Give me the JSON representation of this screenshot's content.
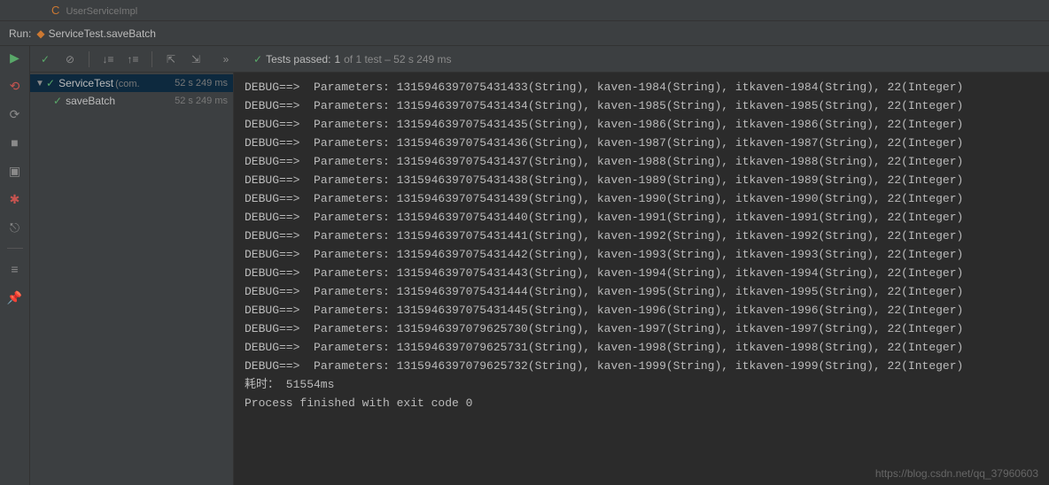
{
  "topbar": {
    "breadcrumb_prefix_icon": "C",
    "breadcrumb_text": "UserServiceImpl"
  },
  "toolbar": {
    "run_label": "Run:",
    "file_icon": "◆",
    "file_name": "ServiceTest.saveBatch"
  },
  "gutter": {
    "run": "▶",
    "stop": "⟲",
    "rerun": "⟳",
    "stop2": "■",
    "camera": "▣",
    "debug": "✱",
    "exit": "⎋",
    "layout": "≡",
    "pin": "📌"
  },
  "toolbar_inner": {
    "check": "✓",
    "block": "⊘",
    "sort_down": "↓≡",
    "sort_up": "↑≡",
    "expand": "⇱",
    "collapse": "⇲",
    "more": "»"
  },
  "test_status": {
    "icon": "✓",
    "label": "Tests passed:",
    "count": "1",
    "of_text": "of 1 test – 52 s 249 ms"
  },
  "tree": {
    "root": {
      "chevron": "▼",
      "check": "✓",
      "name": "ServiceTest",
      "dim": "(com.",
      "time": "52 s 249 ms"
    },
    "child": {
      "check": "✓",
      "name": "saveBatch",
      "time": "52 s 249 ms"
    }
  },
  "console_lines": [
    "DEBUG==>  Parameters: 1315946397075431433(String), kaven-1984(String), itkaven-1984(String), 22(Integer)",
    "DEBUG==>  Parameters: 1315946397075431434(String), kaven-1985(String), itkaven-1985(String), 22(Integer)",
    "DEBUG==>  Parameters: 1315946397075431435(String), kaven-1986(String), itkaven-1986(String), 22(Integer)",
    "DEBUG==>  Parameters: 1315946397075431436(String), kaven-1987(String), itkaven-1987(String), 22(Integer)",
    "DEBUG==>  Parameters: 1315946397075431437(String), kaven-1988(String), itkaven-1988(String), 22(Integer)",
    "DEBUG==>  Parameters: 1315946397075431438(String), kaven-1989(String), itkaven-1989(String), 22(Integer)",
    "DEBUG==>  Parameters: 1315946397075431439(String), kaven-1990(String), itkaven-1990(String), 22(Integer)",
    "DEBUG==>  Parameters: 1315946397075431440(String), kaven-1991(String), itkaven-1991(String), 22(Integer)",
    "DEBUG==>  Parameters: 1315946397075431441(String), kaven-1992(String), itkaven-1992(String), 22(Integer)",
    "DEBUG==>  Parameters: 1315946397075431442(String), kaven-1993(String), itkaven-1993(String), 22(Integer)",
    "DEBUG==>  Parameters: 1315946397075431443(String), kaven-1994(String), itkaven-1994(String), 22(Integer)",
    "DEBUG==>  Parameters: 1315946397075431444(String), kaven-1995(String), itkaven-1995(String), 22(Integer)",
    "DEBUG==>  Parameters: 1315946397075431445(String), kaven-1996(String), itkaven-1996(String), 22(Integer)",
    "DEBUG==>  Parameters: 1315946397079625730(String), kaven-1997(String), itkaven-1997(String), 22(Integer)",
    "DEBUG==>  Parameters: 1315946397079625731(String), kaven-1998(String), itkaven-1998(String), 22(Integer)",
    "DEBUG==>  Parameters: 1315946397079625732(String), kaven-1999(String), itkaven-1999(String), 22(Integer)",
    "耗时： 51554ms",
    "",
    "Process finished with exit code 0"
  ],
  "watermark": "https://blog.csdn.net/qq_37960603"
}
